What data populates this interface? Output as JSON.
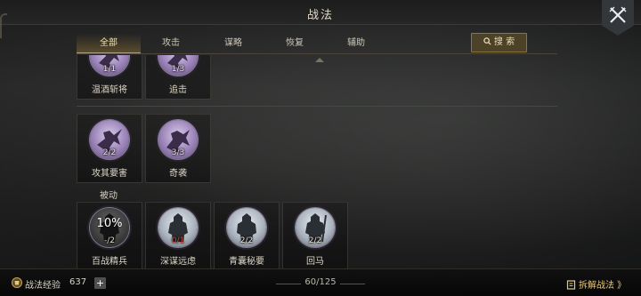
{
  "window": {
    "title": "战法"
  },
  "tabs": [
    {
      "label": "全部",
      "active": true
    },
    {
      "label": "攻击",
      "active": false
    },
    {
      "label": "谋略",
      "active": false
    },
    {
      "label": "恢复",
      "active": false
    },
    {
      "label": "辅助",
      "active": false
    }
  ],
  "search": {
    "label": "搜 索",
    "icon": "search-icon"
  },
  "groups": [
    {
      "label": "",
      "cards": [
        {
          "name": "温酒斩将",
          "level": "1/1",
          "icon": "warrior-icon",
          "theme": "purple"
        },
        {
          "name": "追击",
          "level": "1/3",
          "icon": "warrior-icon",
          "theme": "purple"
        }
      ]
    },
    {
      "label": "",
      "cards": [
        {
          "name": "攻其要害",
          "level": "2/2",
          "icon": "warrior-icon",
          "theme": "purple"
        },
        {
          "name": "奇袭",
          "level": "3/3",
          "icon": "warrior-icon",
          "theme": "purple"
        }
      ]
    },
    {
      "label": "被动",
      "cards": [
        {
          "name": "百战精兵",
          "level": "-/2",
          "percent": "10%",
          "icon": "soldier-icon",
          "theme": "dark"
        },
        {
          "name": "深谋远虑",
          "level": "0/1",
          "icon": "soldier-icon",
          "theme": "steel",
          "level_color": "#d24a3b"
        },
        {
          "name": "青囊秘要",
          "level": "2/2",
          "icon": "soldier-icon",
          "theme": "steel"
        },
        {
          "name": "回马",
          "level": "2/2",
          "icon": "soldier-icon",
          "theme": "steel"
        }
      ]
    }
  ],
  "footer": {
    "exp_label": "战法经验",
    "exp_value": "637",
    "plus_label": "+",
    "count": "60/125",
    "decompose_label": "拆解战法 》"
  },
  "colors": {
    "accent": "#c8a24c",
    "gold_text": "#e6c879",
    "purple_icon": "#9b83b9",
    "steel_icon": "#aab3be"
  }
}
